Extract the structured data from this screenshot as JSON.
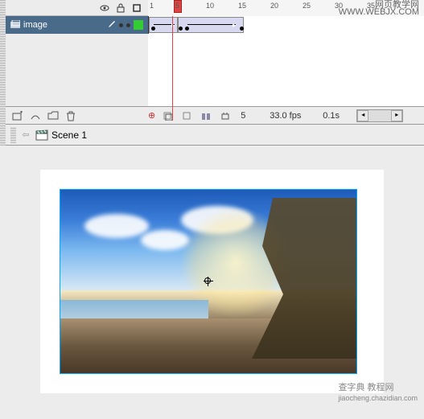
{
  "watermark": {
    "top_line1": "网页教学网",
    "top_line2": "WWW.WEBJX.COM",
    "bottom": "查字典  教程网",
    "bottom_url": "jiaocheng.chazidian.com"
  },
  "timeline": {
    "ruler_marks": [
      1,
      5,
      10,
      15,
      20,
      25,
      30,
      35
    ],
    "current_frame": 5,
    "fps": "33.0 fps",
    "elapsed": "0.1s",
    "layer": {
      "name": "image",
      "color": "#33cc33"
    }
  },
  "scene": {
    "name": "Scene 1"
  }
}
